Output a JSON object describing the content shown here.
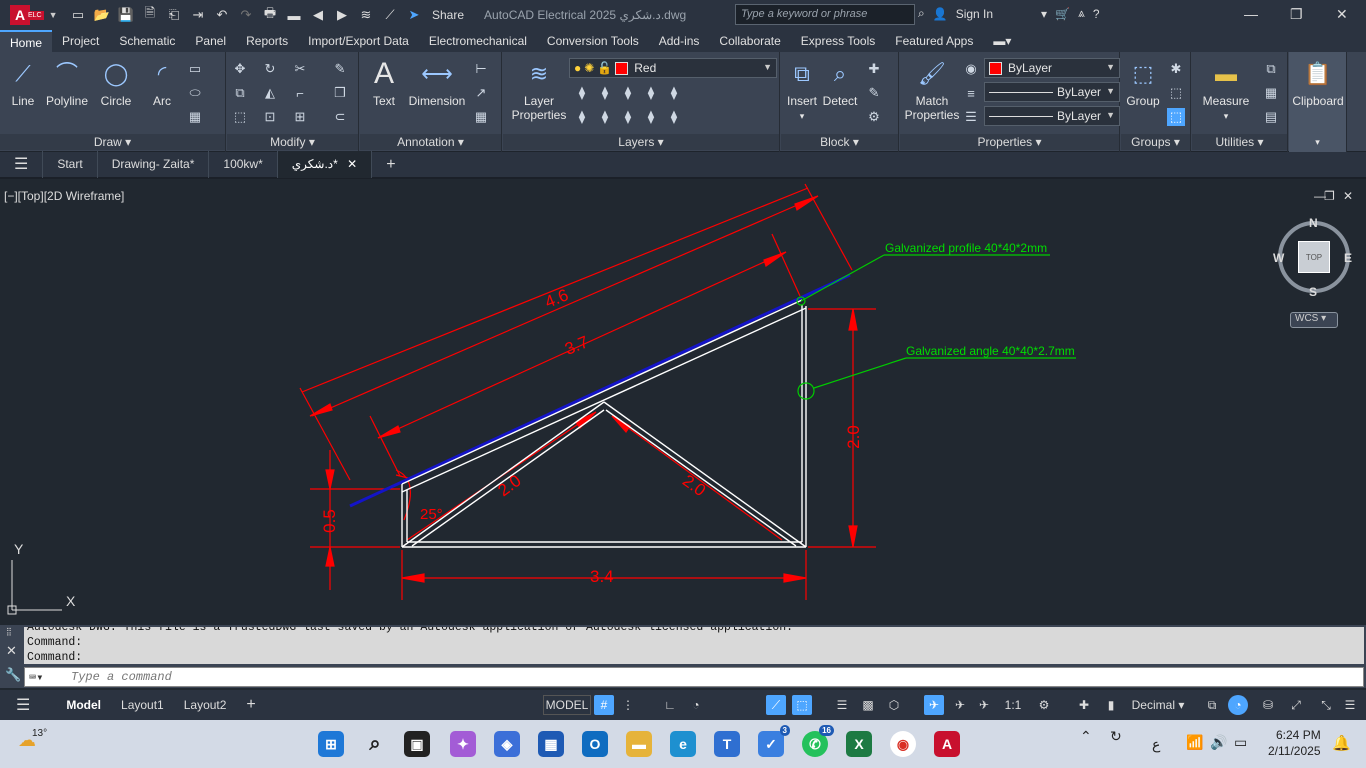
{
  "titlebar": {
    "share_label": "Share",
    "app_title": "AutoCAD Electrical 2025   د.شكري.dwg",
    "search_placeholder": "Type a keyword or phrase",
    "sign_in": "Sign In"
  },
  "menubar": {
    "items": [
      "Home",
      "Project",
      "Schematic",
      "Panel",
      "Reports",
      "Import/Export Data",
      "Electromechanical",
      "Conversion Tools",
      "Add-ins",
      "Collaborate",
      "Express Tools",
      "Featured Apps"
    ]
  },
  "ribbon": {
    "draw": {
      "line": "Line",
      "polyline": "Polyline",
      "circle": "Circle",
      "arc": "Arc",
      "label": "Draw"
    },
    "modify": {
      "label": "Modify"
    },
    "annotation": {
      "text": "Text",
      "dimension": "Dimension",
      "label": "Annotation"
    },
    "layers": {
      "layer_properties_1": "Layer",
      "layer_properties_2": "Properties",
      "current_layer": "Red",
      "label": "Layers"
    },
    "block": {
      "insert": "Insert",
      "detect": "Detect",
      "label": "Block"
    },
    "properties": {
      "match_1": "Match",
      "match_2": "Properties",
      "color": "ByLayer",
      "linetype": "ByLayer",
      "lineweight": "ByLayer",
      "label": "Properties"
    },
    "groups": {
      "group": "Group",
      "label": "Groups"
    },
    "utilities": {
      "measure": "Measure",
      "label": "Utilities"
    },
    "clipboard": {
      "label": "Clipboard"
    }
  },
  "doctabs": [
    "Start",
    "Drawing- Zaita*",
    "100kw*",
    "د.شكري*"
  ],
  "viewport": {
    "label": "[−][Top][2D Wireframe]",
    "viewcube": {
      "n": "N",
      "s": "S",
      "e": "E",
      "w": "W",
      "top": "TOP",
      "wcs": "WCS"
    }
  },
  "drawing": {
    "dim_46": "4.6",
    "dim_37": "3.7",
    "dim_20_right": "2.0",
    "dim_20_left_diag": "2.0",
    "dim_20_right_diag": "2.0",
    "dim_05": "0.5",
    "dim_34": "3.4",
    "angle": "25°",
    "leader_profile": "Galvanized profile 40*40*2mm",
    "leader_angle": "Galvanized angle 40*40*2.7mm",
    "ucs_x": "X",
    "ucs_y": "Y",
    "colors": {
      "dim": "#ff0000",
      "frame": "#ffffff",
      "profile": "#1010c8",
      "leader": "#00cc00"
    }
  },
  "command": {
    "history": [
      "Autodesk DWG.  This file is a TrustedDWG last saved by an Autodesk application or Autodesk licensed application.",
      "Command:",
      "Command:"
    ],
    "placeholder": "Type a command"
  },
  "statusbar": {
    "tabs": [
      "Model",
      "Layout1",
      "Layout2"
    ],
    "model": "MODEL",
    "scale": "1:1",
    "units": "Decimal"
  },
  "taskbar": {
    "temp": "13°",
    "badge_todo": "3",
    "badge_whatsapp": "16",
    "lang": "ع",
    "time": "6:24 PM",
    "date": "2/11/2025"
  }
}
